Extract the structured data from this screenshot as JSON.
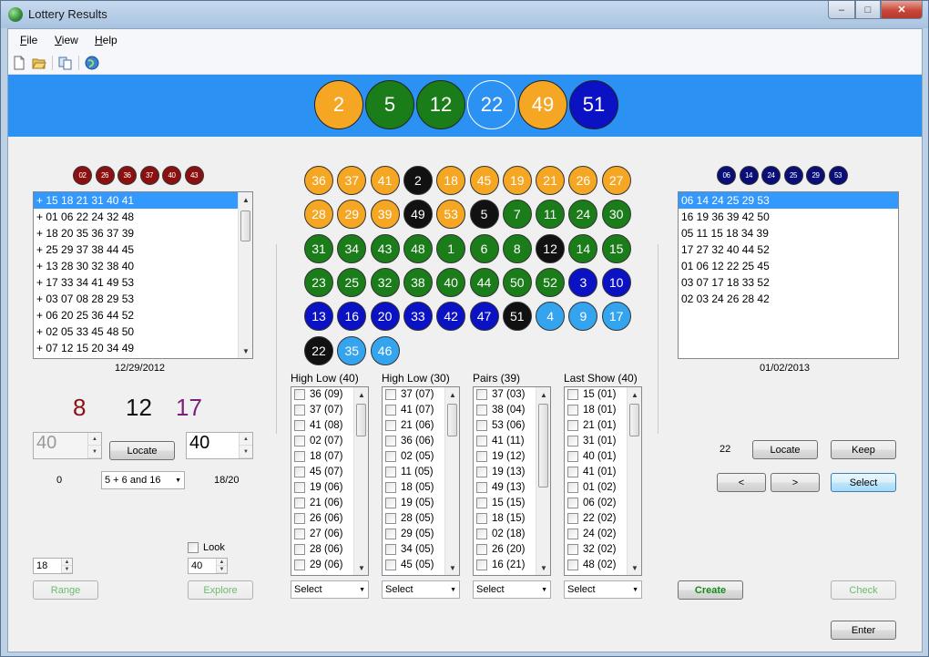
{
  "window": {
    "title": "Lottery Results",
    "min": "–",
    "max": "□",
    "close": "✕"
  },
  "menu": [
    "File",
    "View",
    "Help"
  ],
  "toolbar": {
    "icons": [
      "new-file-icon",
      "open-folder-icon",
      "copy-icon",
      "web-icon"
    ]
  },
  "drawn_balls": [
    {
      "n": "2",
      "color": "#f5a623"
    },
    {
      "n": "5",
      "color": "#1a7d1a"
    },
    {
      "n": "12",
      "color": "#1a7d1a"
    },
    {
      "n": "22",
      "color": "#2b91f2"
    },
    {
      "n": "49",
      "color": "#f5a623"
    },
    {
      "n": "51",
      "color": "#0b12c4"
    }
  ],
  "left": {
    "small_balls": [
      "02",
      "26",
      "36",
      "37",
      "40",
      "43"
    ],
    "list": [
      "+ 15 18 21 31 40 41",
      "+ 01 06 22 24 32 48",
      "+ 18 20 35 36 37 39",
      "+ 25 29 37 38 44 45",
      "+ 13 28 30 32 38 40",
      "+ 17 33 34 41 49 53",
      "+ 03 07 08 28 29 53",
      "+ 06 20 25 36 44 52",
      "+ 02 05 33 45 48 50",
      "+ 07 12 15 20 34 49"
    ],
    "date": "12/29/2012",
    "stats": {
      "a": "8",
      "b": "12",
      "c": "17"
    },
    "spin_left": "40",
    "locate_label": "Locate",
    "spin_right": "40",
    "count_zero": "0",
    "combo": "5 + 6 and 16",
    "ratio": "18/20",
    "small_spin": "18",
    "look_label": "Look",
    "small_spin2": "40",
    "range_label": "Range",
    "explore_label": "Explore"
  },
  "grid_balls": [
    [
      "36",
      "o"
    ],
    [
      "37",
      "o"
    ],
    [
      "41",
      "o"
    ],
    [
      "2",
      "k"
    ],
    [
      "18",
      "o"
    ],
    [
      "45",
      "o"
    ],
    [
      "19",
      "o"
    ],
    [
      "21",
      "o"
    ],
    [
      "26",
      "o"
    ],
    [
      "27",
      "o"
    ],
    [
      "28",
      "o"
    ],
    [
      "29",
      "o"
    ],
    [
      "39",
      "o"
    ],
    [
      "49",
      "k"
    ],
    [
      "53",
      "o"
    ],
    [
      "5",
      "k"
    ],
    [
      "7",
      "g"
    ],
    [
      "11",
      "g"
    ],
    [
      "24",
      "g"
    ],
    [
      "30",
      "g"
    ],
    [
      "31",
      "g"
    ],
    [
      "34",
      "g"
    ],
    [
      "43",
      "g"
    ],
    [
      "48",
      "g"
    ],
    [
      "1",
      "g"
    ],
    [
      "6",
      "g"
    ],
    [
      "8",
      "g"
    ],
    [
      "12",
      "k"
    ],
    [
      "14",
      "g"
    ],
    [
      "15",
      "g"
    ],
    [
      "23",
      "g"
    ],
    [
      "25",
      "g"
    ],
    [
      "32",
      "g"
    ],
    [
      "38",
      "g"
    ],
    [
      "40",
      "g"
    ],
    [
      "44",
      "g"
    ],
    [
      "50",
      "g"
    ],
    [
      "52",
      "g"
    ],
    [
      "3",
      "n"
    ],
    [
      "10",
      "n"
    ],
    [
      "13",
      "n"
    ],
    [
      "16",
      "n"
    ],
    [
      "20",
      "n"
    ],
    [
      "33",
      "n"
    ],
    [
      "42",
      "n"
    ],
    [
      "47",
      "n"
    ],
    [
      "51",
      "k"
    ],
    [
      "4",
      "s"
    ],
    [
      "9",
      "s"
    ],
    [
      "17",
      "s"
    ],
    [
      "22",
      "k"
    ],
    [
      "35",
      "s"
    ],
    [
      "46",
      "s"
    ]
  ],
  "checklists": [
    {
      "title": "High Low (40)",
      "items": [
        "36 (09)",
        "37 (07)",
        "41 (08)",
        "02 (07)",
        "18 (07)",
        "45 (07)",
        "19 (06)",
        "21 (06)",
        "26 (06)",
        "27 (06)",
        "28 (06)",
        "29 (06)"
      ],
      "select": "Select"
    },
    {
      "title": "High Low (30)",
      "items": [
        "37 (07)",
        "41 (07)",
        "21 (06)",
        "36 (06)",
        "02 (05)",
        "11 (05)",
        "18 (05)",
        "19 (05)",
        "28 (05)",
        "29 (05)",
        "34 (05)",
        "45 (05)"
      ],
      "select": "Select"
    },
    {
      "title": "Pairs (39)",
      "items": [
        "37 (03)",
        "38 (04)",
        "53 (06)",
        "41 (11)",
        "19 (12)",
        "19 (13)",
        "49 (13)",
        "15 (15)",
        "18 (15)",
        "02 (18)",
        "26 (20)",
        "16 (21)"
      ],
      "select": "Select"
    },
    {
      "title": "Last Show (40)",
      "items": [
        "15 (01)",
        "18 (01)",
        "21 (01)",
        "31 (01)",
        "40 (01)",
        "41 (01)",
        "01 (02)",
        "06 (02)",
        "22 (02)",
        "24 (02)",
        "32 (02)",
        "48 (02)"
      ],
      "select": "Select"
    }
  ],
  "right": {
    "small_balls": [
      "06",
      "14",
      "24",
      "25",
      "29",
      "53"
    ],
    "list": [
      "06 14 24 25 29 53",
      "16 19 36 39 42 50",
      "05 11 15 18 34 39",
      "17 27 32 40 44 52",
      "01 06 12 22 25 45",
      "03 07 17 18 33 52",
      "02 03 24 26 28 42"
    ],
    "date": "01/02/2013",
    "count": "22",
    "locate_label": "Locate",
    "keep_label": "Keep",
    "prev_label": "<",
    "next_label": ">",
    "select_label": "Select",
    "create_label": "Create",
    "check_label": "Check",
    "enter_label": "Enter"
  }
}
